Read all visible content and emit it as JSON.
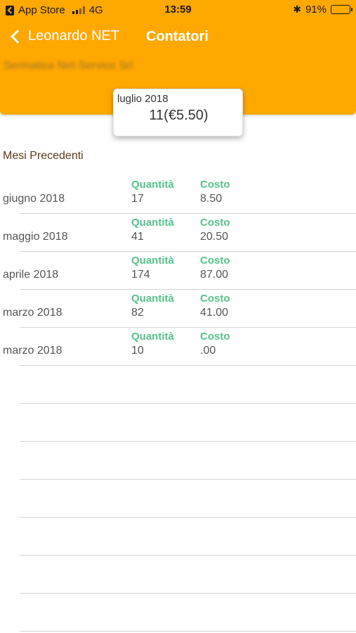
{
  "status_bar": {
    "back_app": "App Store",
    "network": "4G",
    "time": "13:59",
    "battery": "91%"
  },
  "nav": {
    "back_label": "Leonardo NET",
    "title": "Contatori"
  },
  "header": {
    "company": "Sermatica Net-Service Srl"
  },
  "current": {
    "month": "luglio 2018",
    "value": "11(€5.50)"
  },
  "previous": {
    "title": "Mesi Precedenti",
    "quantity_header": "Quantità",
    "cost_header": "Costo",
    "rows": [
      {
        "month": "giugno 2018",
        "quantity": "17",
        "cost": "8.50"
      },
      {
        "month": "maggio 2018",
        "quantity": "41",
        "cost": "20.50"
      },
      {
        "month": "aprile 2018",
        "quantity": "174",
        "cost": "87.00"
      },
      {
        "month": "marzo 2018",
        "quantity": "82",
        "cost": "41.00"
      },
      {
        "month": "marzo 2018",
        "quantity": "10",
        "cost": ".00"
      }
    ]
  },
  "colors": {
    "accent": "#ffa800",
    "header_green": "#55c28a"
  }
}
